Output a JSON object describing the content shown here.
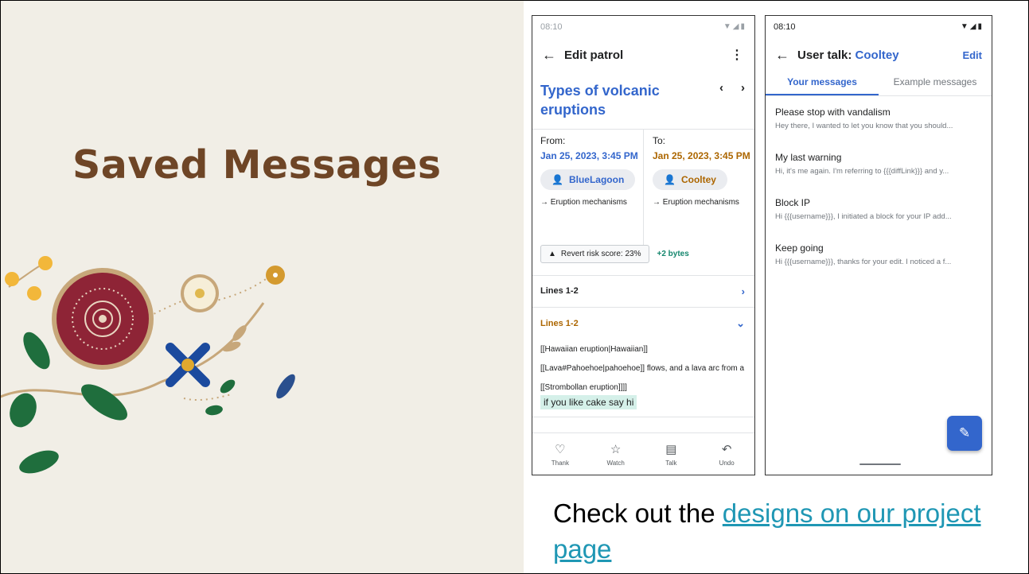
{
  "slide": {
    "title": "Saved Messages",
    "caption_prefix": "Check out the ",
    "caption_link": "designs on our project page"
  },
  "colors": {
    "title": "#6e4526",
    "accent_blue": "#3366cc",
    "accent_gold": "#ac6600",
    "added_green": "#14866d",
    "link": "#1f97b4"
  },
  "phone_a": {
    "status_time": "08:10",
    "status_icons": "▼◢▮",
    "back_icon": "←",
    "title": "Edit patrol",
    "menu_icon": "⋮",
    "article_title": "Types of volcanic eruptions",
    "prev_icon": "‹",
    "next_icon": "›",
    "from_label": "From:",
    "from_date": "Jan 25, 2023, 3:45 PM",
    "from_user": "BlueLagoon",
    "from_section": "→ Eruption mechanisms",
    "to_label": "To:",
    "to_date": "Jan 25, 2023, 3:45 PM",
    "to_user": "Cooltey",
    "to_section": "→ Eruption mechanisms",
    "person_icon": "👤",
    "warning_icon": "▲",
    "revert_risk": "Revert risk score: 23%",
    "bytes": "+2 bytes",
    "lines_collapsed": "Lines 1-2",
    "chevron_right": "›",
    "lines_expanded": "Lines 1-2",
    "chevron_down": "⌄",
    "diff_text": "[[Hawaiian eruption|Hawaiian]] [[Lava#Pahoehoe|pahoehoe]] flows, and a lava arc from a [[Strombollan eruption]]]]",
    "diff_added": "if you like cake say hi",
    "nav": [
      {
        "icon": "♡",
        "label": "Thank"
      },
      {
        "icon": "☆",
        "label": "Watch"
      },
      {
        "icon": "▤",
        "label": "Talk"
      },
      {
        "icon": "↶",
        "label": "Undo"
      }
    ]
  },
  "phone_b": {
    "status_time": "08:10",
    "status_icons": "▼◢▮",
    "back_icon": "←",
    "title_prefix": "User talk: ",
    "title_user": "Cooltey",
    "edit_label": "Edit",
    "tabs": [
      "Your messages",
      "Example messages"
    ],
    "messages": [
      {
        "title": "Please stop with vandalism",
        "preview": "Hey there, I wanted to let you know that you should..."
      },
      {
        "title": "My last warning",
        "preview": "Hi, it's me again. I'm referring to {{{diffLink}}} and y..."
      },
      {
        "title": "Block IP",
        "preview": "Hi {{{username}}}, I initiated a block for your IP add..."
      },
      {
        "title": "Keep going",
        "preview": "Hi {{{username}}}, thanks for your edit. I noticed a f..."
      }
    ],
    "fab_icon": "✎"
  }
}
